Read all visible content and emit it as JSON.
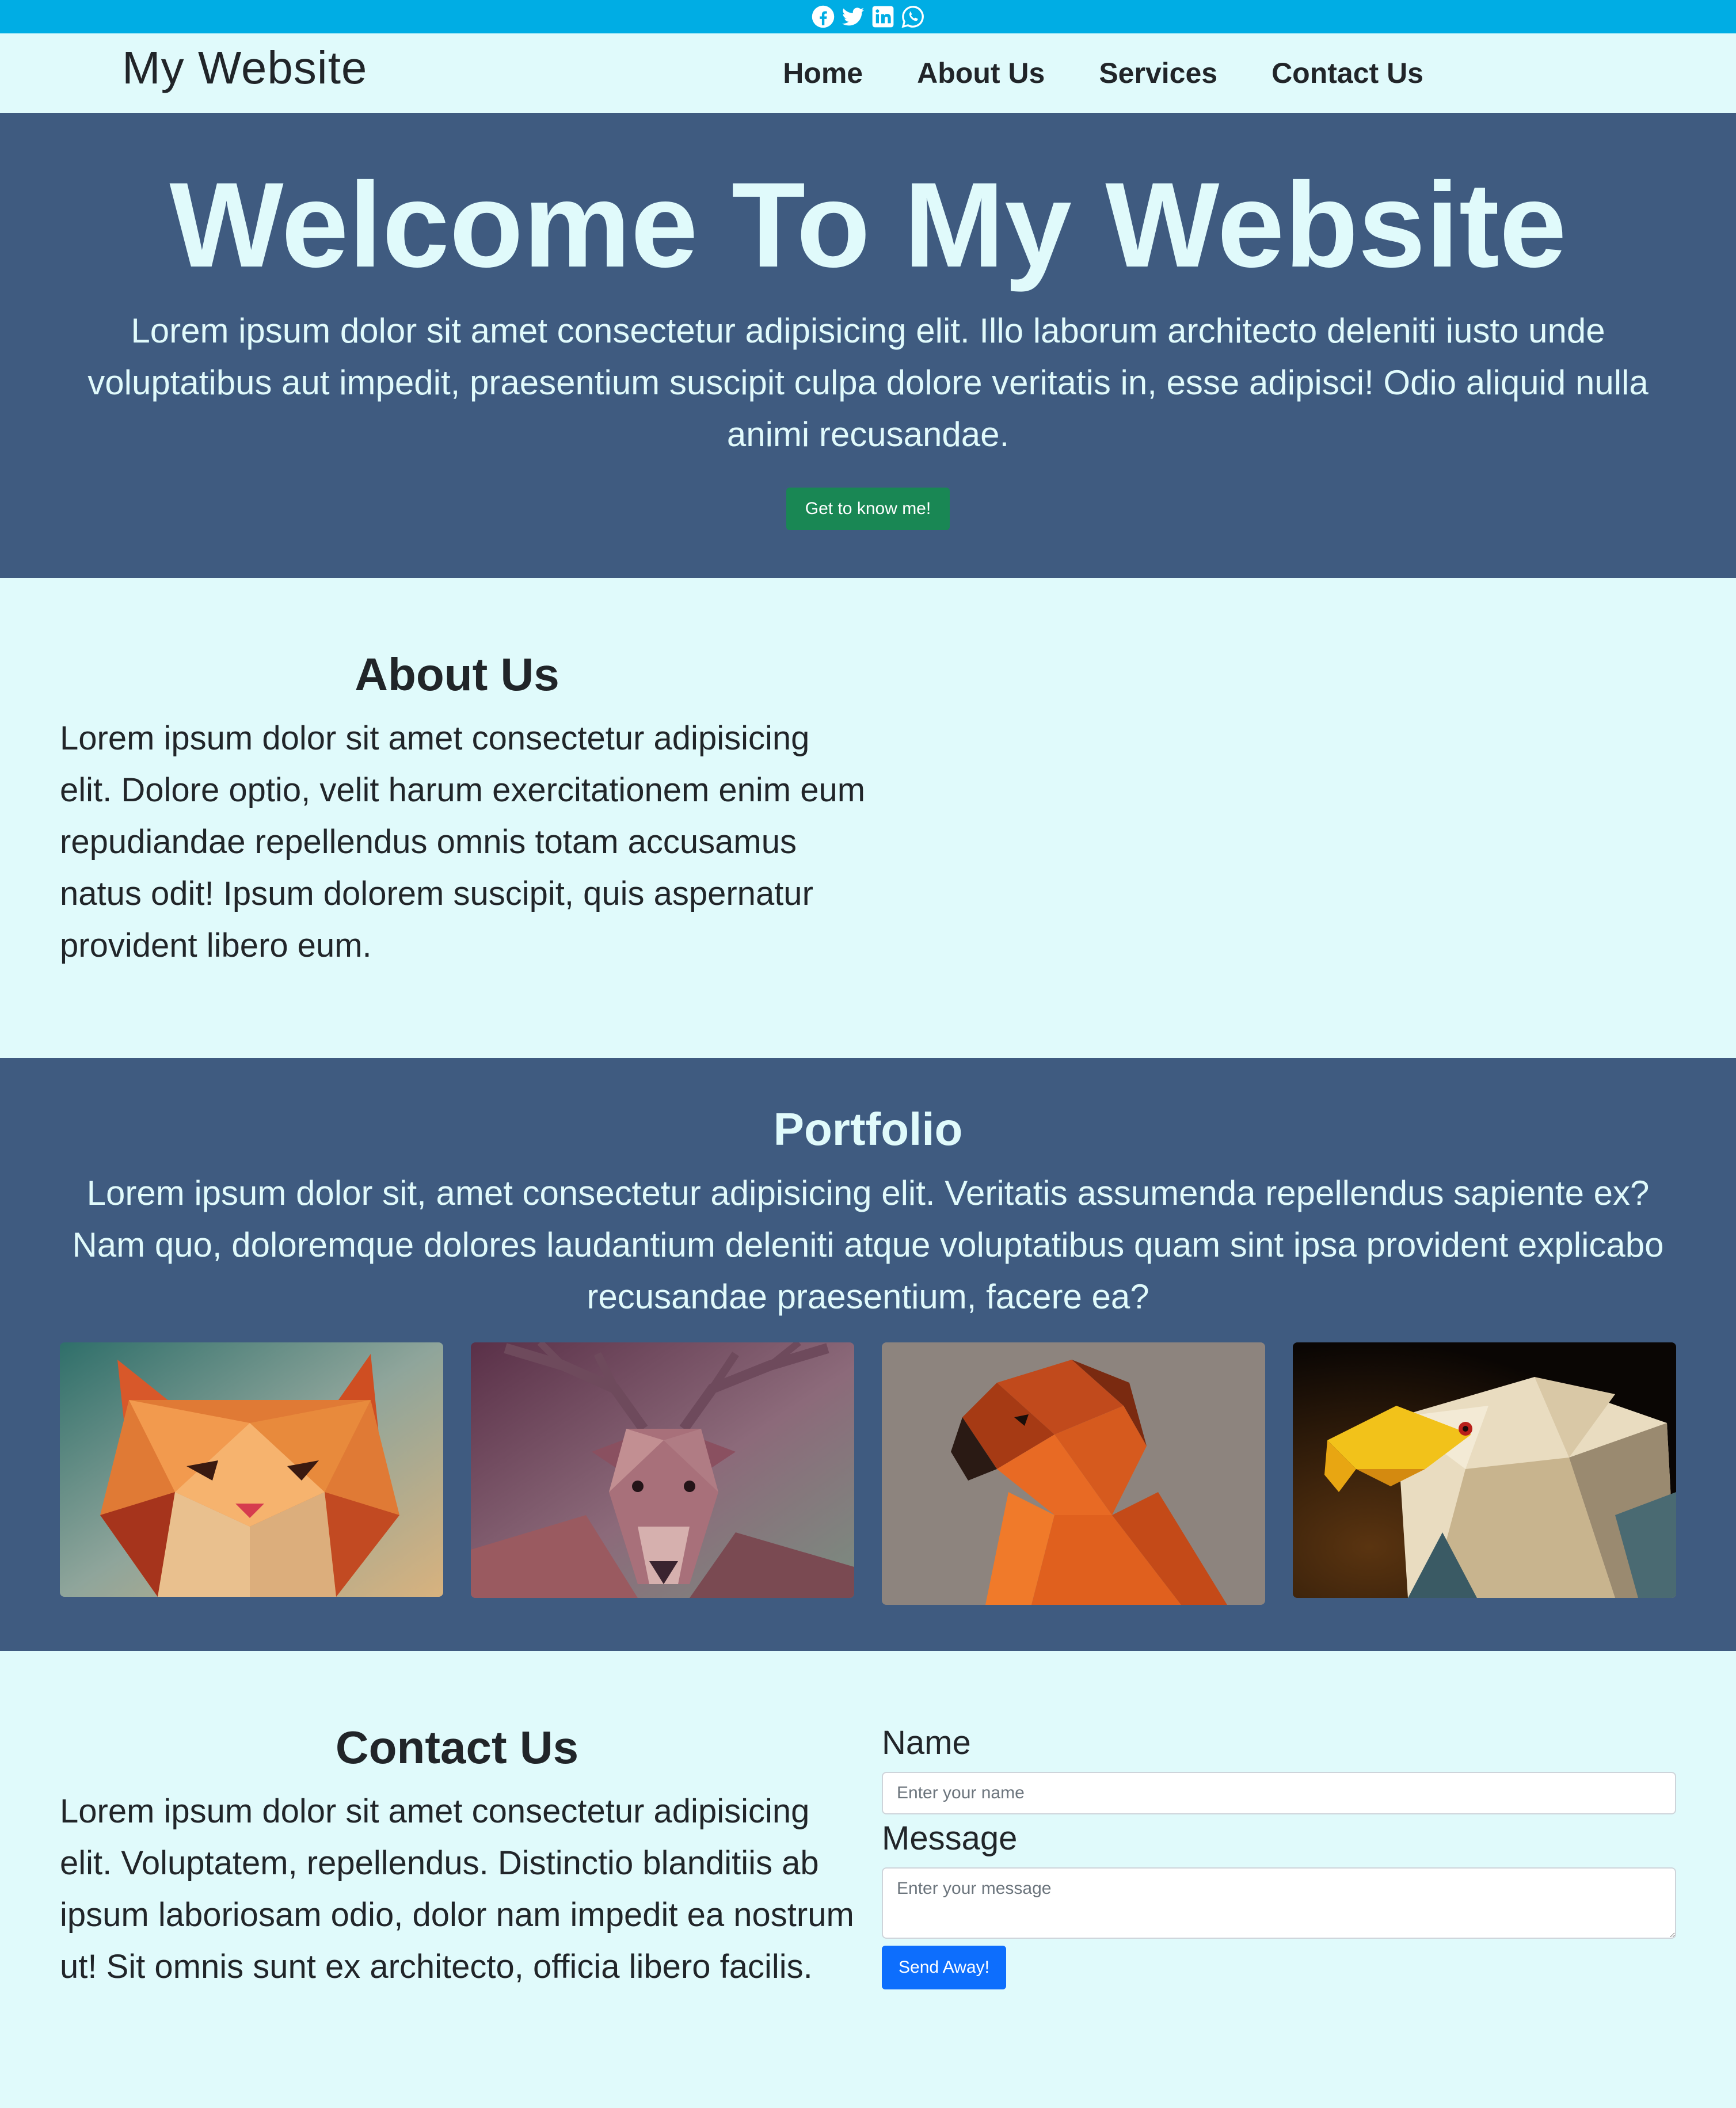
{
  "social": {
    "icons": [
      "facebook-icon",
      "twitter-icon",
      "linkedin-icon",
      "whatsapp-icon"
    ]
  },
  "navbar": {
    "brand": "My Website",
    "links": [
      "Home",
      "About Us",
      "Services",
      "Contact Us"
    ]
  },
  "hero": {
    "title": "Welcome To My Website",
    "text": "Lorem ipsum dolor sit amet consectetur adipisicing elit. Illo laborum architecto deleniti iusto unde voluptatibus aut impedit, praesentium suscipit culpa dolore veritatis in, esse adipisci! Odio aliquid nulla animi recusandae.",
    "button_label": "Get to know me!"
  },
  "about": {
    "title": "About Us",
    "text": "Lorem ipsum dolor sit amet consectetur adipisicing elit. Dolore optio, velit harum exercitationem enim eum repudiandae repellendus omnis totam accusamus natus odit! Ipsum dolorem suscipit, quis aspernatur provident libero eum."
  },
  "portfolio": {
    "title": "Portfolio",
    "text": "Lorem ipsum dolor sit, amet consectetur adipisicing elit. Veritatis assumenda repellendus sapiente ex? Nam quo, doloremque dolores laudantium deleniti atque voluptatibus quam sint ipsa provident explicabo recusandae praesentium, facere ea?",
    "images": [
      "cat",
      "deer",
      "dog",
      "eagle"
    ]
  },
  "contact": {
    "title": "Contact Us",
    "text": "Lorem ipsum dolor sit amet consectetur adipisicing elit. Voluptatem, repellendus. Distinctio blanditiis ab ipsum laboriosam odio, dolor nam impedit ea nostrum ut! Sit omnis sunt ex architecto, officia libero facilis.",
    "name_label": "Name",
    "name_placeholder": "Enter your name",
    "name_value": "",
    "message_label": "Message",
    "message_placeholder": "Enter your message",
    "message_value": "",
    "send_label": "Send Away!"
  },
  "colors": {
    "social_bar": "#00ade4",
    "page_background": "#e0fafb",
    "section_dark": "#3f5b80",
    "hero_button": "#198754",
    "send_button": "#0d6efd"
  }
}
